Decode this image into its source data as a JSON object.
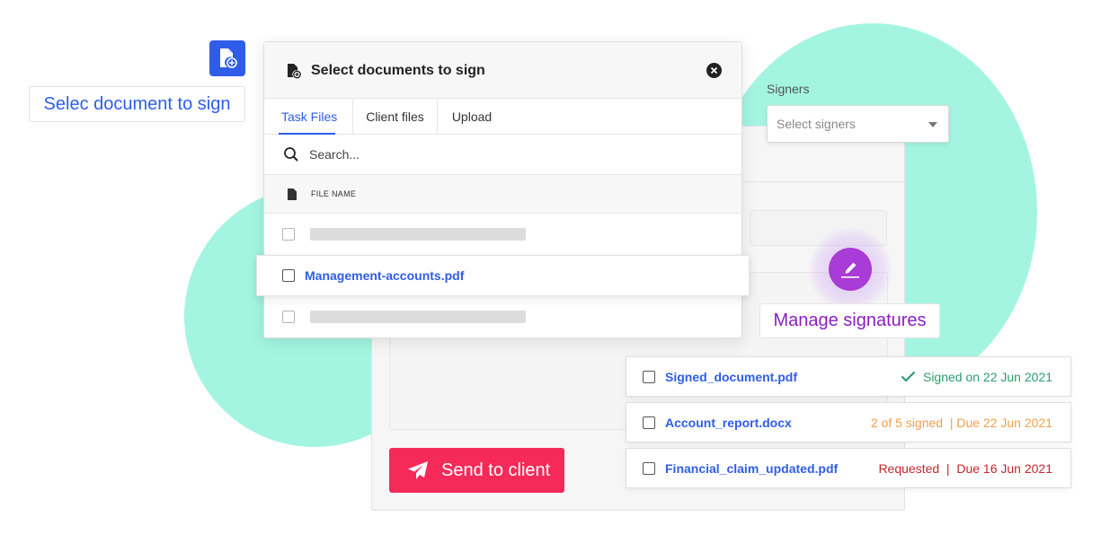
{
  "colors": {
    "accent_blue": "#2f5de8",
    "mint": "#a3f5e1",
    "send_red": "#f52a59",
    "signature_purple": "#a93bd6",
    "signed_green": "#2a9d6f",
    "progress_orange": "#f0a04b",
    "requested_red": "#c0282d"
  },
  "callout": {
    "icon": "file-plus-icon",
    "label": "Selec document to sign"
  },
  "modal": {
    "title": "Select documents to sign",
    "title_icon": "file-plus-icon",
    "close_icon": "close-icon",
    "tabs": [
      "Task Files",
      "Client files",
      "Upload"
    ],
    "active_tab": "Task Files",
    "search": {
      "placeholder": "Search..."
    },
    "column_header": "FILE NAME",
    "rows": [
      {
        "name": "",
        "placeholder": true
      },
      {
        "name": "Management-accounts.pdf",
        "placeholder": false,
        "highlighted": true
      },
      {
        "name": "",
        "placeholder": true
      }
    ]
  },
  "signers": {
    "label": "Signers",
    "placeholder": "Select signers"
  },
  "signatures": {
    "icon": "pen-signature-icon",
    "label": "Manage signatures"
  },
  "send_button": {
    "icon": "paper-plane-icon",
    "label": "Send to client"
  },
  "files": [
    {
      "name": "Signed_document.pdf",
      "status": "Signed on 22 Jun 2021",
      "status_icon": "check-icon",
      "status_color": "#2a9d6f"
    },
    {
      "name": "Account_report.docx",
      "status": "2 of 5 signed  | Due 22 Jun 2021",
      "status_color": "#f0a04b"
    },
    {
      "name": "Financial_claim_updated.pdf",
      "status": "Requested  |  Due 16 Jun 2021",
      "status_color": "#c0282d"
    }
  ]
}
